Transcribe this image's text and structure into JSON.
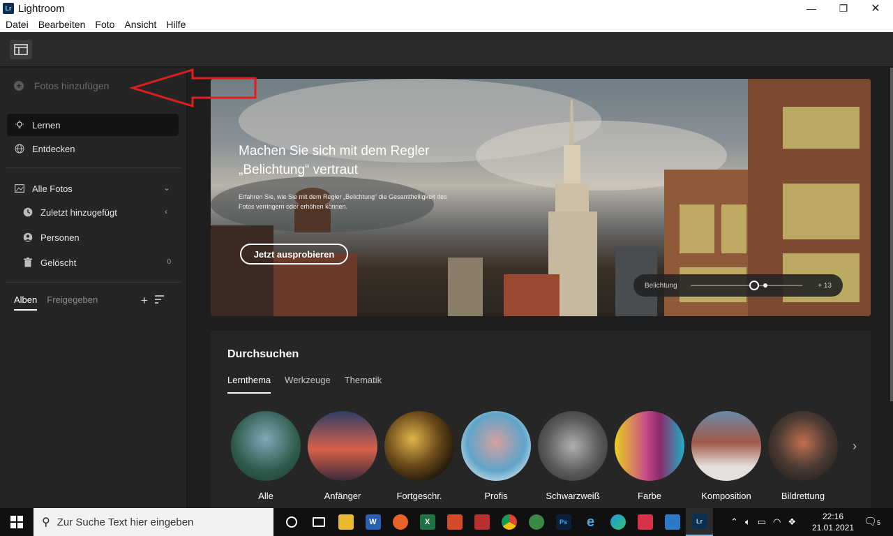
{
  "window": {
    "app_logo": "Lr",
    "title": "Lightroom",
    "minimize": "—",
    "maximize": "❐",
    "close": "✕"
  },
  "menu": [
    "Datei",
    "Bearbeiten",
    "Foto",
    "Ansicht",
    "Hilfe"
  ],
  "sidebar": {
    "add_photos": "Fotos hinzufügen",
    "nav": [
      {
        "label": "Lernen",
        "icon": "lightbulb-icon"
      },
      {
        "label": "Entdecken",
        "icon": "globe-icon"
      }
    ],
    "all_photos": "Alle Fotos",
    "sub_items": [
      {
        "label": "Zuletzt hinzugefügt",
        "icon": "clock-icon"
      },
      {
        "label": "Personen",
        "icon": "person-icon"
      },
      {
        "label": "Gelöscht",
        "icon": "trash-icon",
        "count": "0"
      }
    ],
    "tabs": [
      "Alben",
      "Freigegeben"
    ]
  },
  "hero": {
    "title": "Machen Sie sich mit dem Regler „Belichtung“ vertraut",
    "subtitle": "Erfahren Sie, wie Sie mit dem Regler „Belichtung“ die Gesamthelligkeit des Fotos verringern oder erhöhen können.",
    "button": "Jetzt ausprobieren",
    "slider_label": "Belichtung",
    "slider_value": "+ 13"
  },
  "browse": {
    "title": "Durchsuchen",
    "tabs": [
      "Lernthema",
      "Werkzeuge",
      "Thematik"
    ],
    "categories": [
      {
        "label": "Alle",
        "color": "#3d6a64"
      },
      {
        "label": "Anfänger",
        "color": "#c0504a"
      },
      {
        "label": "Fortgeschr.",
        "color": "#5a4520"
      },
      {
        "label": "Profis",
        "color": "#5fa4c8"
      },
      {
        "label": "Schwarzweiß",
        "color": "#6a6a6a"
      },
      {
        "label": "Farbe",
        "color": "#c84b8a"
      },
      {
        "label": "Komposition",
        "color": "#7a5a56"
      },
      {
        "label": "Bildrettung",
        "color": "#4a3a34"
      }
    ]
  },
  "taskbar": {
    "search_placeholder": "Zur Suche Text hier eingeben",
    "time": "22:16",
    "date": "21.01.2021",
    "notifications": "5"
  }
}
